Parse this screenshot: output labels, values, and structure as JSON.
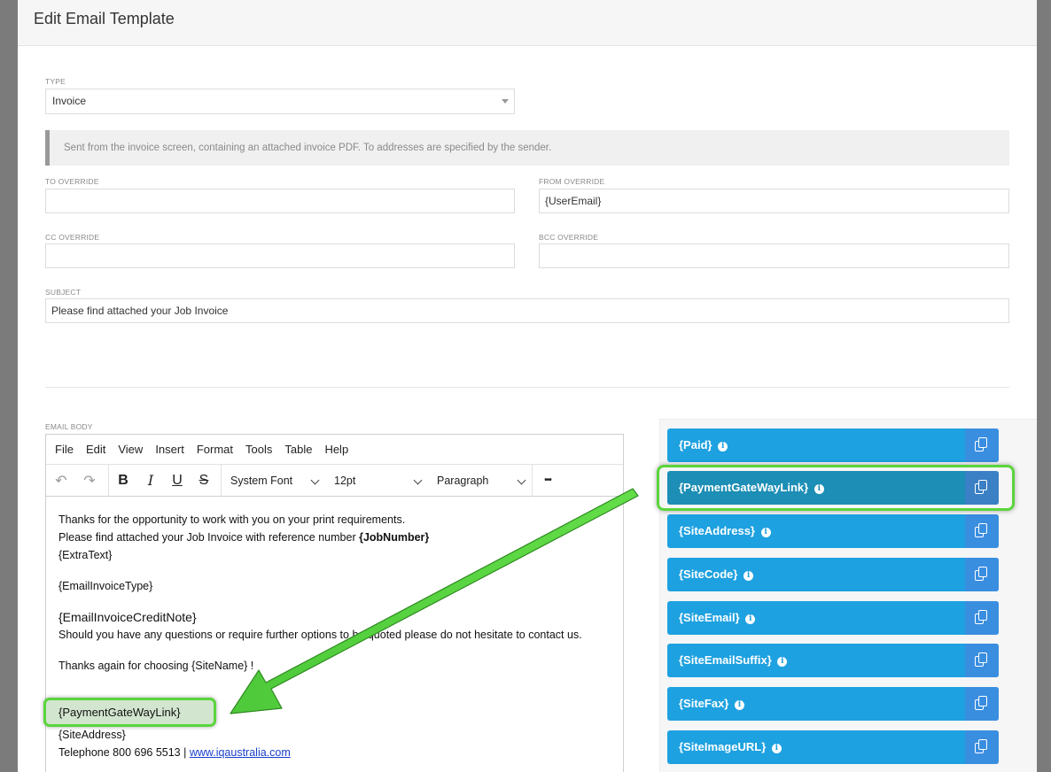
{
  "title": "Edit Email Template",
  "type": {
    "label": "TYPE",
    "value": "Invoice"
  },
  "info_text": "Sent from the invoice screen, containing an attached invoice PDF. To addresses are specified by the sender.",
  "to_override": {
    "label": "TO OVERRIDE",
    "value": ""
  },
  "from_override": {
    "label": "FROM OVERRIDE",
    "value": "{UserEmail}"
  },
  "cc_override": {
    "label": "CC OVERRIDE",
    "value": ""
  },
  "bcc_override": {
    "label": "BCC OVERRIDE",
    "value": ""
  },
  "subject": {
    "label": "SUBJECT",
    "value": "Please find attached your Job Invoice"
  },
  "email_body_label": "EMAIL BODY",
  "menu": [
    "File",
    "Edit",
    "View",
    "Insert",
    "Format",
    "Tools",
    "Table",
    "Help"
  ],
  "toolbar": {
    "undo": "↶",
    "redo": "↷",
    "bold": "B",
    "italic": "I",
    "underline": "U",
    "strike": "S",
    "font": "System Font",
    "size": "12pt",
    "block": "Paragraph",
    "more": "•••"
  },
  "body": {
    "line1": "Thanks for the opportunity to work with you on your print requirements.",
    "line2_pre": "Please find attached your Job Invoice with reference number ",
    "line2_bold": "{JobNumber}",
    "line3": "{ExtraText}",
    "line4": "{EmailInvoiceType}",
    "line5": "{EmailInvoiceCreditNote}",
    "line6": "Should you have any questions or require further options to be quoted please do not hesitate to contact us.",
    "line7": "Thanks again for choosing  {SiteName} !",
    "line8": "{PaymentGateWayLink}",
    "line9": "{SiteAddress}",
    "line10_pre": "Telephone 800 696 5513 |  ",
    "line10_link": "www.iqaustralia.com"
  },
  "placeholders": [
    "{Paid}",
    "{PaymentGateWayLink}",
    "{SiteAddress}",
    "{SiteCode}",
    "{SiteEmail}",
    "{SiteEmailSuffix}",
    "{SiteFax}",
    "{SiteImageURL}"
  ],
  "colors": {
    "chip": "#1ea1e0",
    "chip_selected": "#1d8eb5",
    "highlight": "#5ad53c"
  },
  "icons": {
    "info": "info-icon",
    "copy": "copy-icon"
  }
}
